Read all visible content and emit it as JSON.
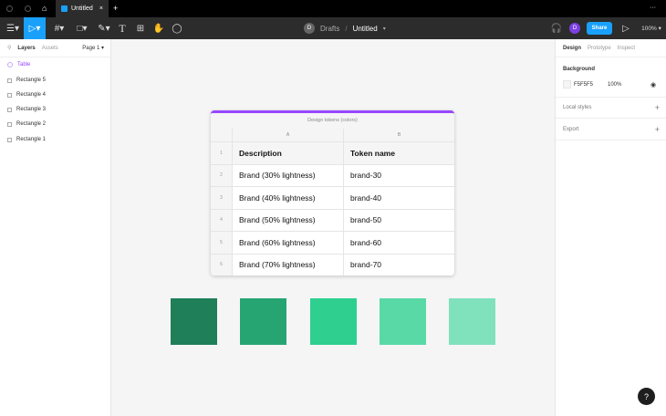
{
  "tab": {
    "title": "Untitled",
    "close": "×",
    "add": "+",
    "more": "···"
  },
  "toolbar": {
    "breadcrumb_parent": "Drafts",
    "separator": "/",
    "file_name": "Untitled",
    "avatar_initial": "D",
    "user_initial": "D",
    "share_label": "Share",
    "zoom": "100%",
    "text_tool": "T"
  },
  "left_panel": {
    "tabs": [
      "Layers",
      "Assets"
    ],
    "page": "Page 1",
    "layers": [
      "Table",
      "Rectangle 5",
      "Rectangle 4",
      "Rectangle 3",
      "Rectangle 2",
      "Rectangle 1"
    ]
  },
  "right_panel": {
    "tabs": [
      "Design",
      "Prototype",
      "Inspect"
    ],
    "background_label": "Background",
    "bg_hex": "F5F5F5",
    "bg_opacity": "100%",
    "local_styles": "Local styles",
    "export": "Export",
    "plus": "+"
  },
  "table": {
    "title": "Design tokens (colors)",
    "columns": [
      "A",
      "B"
    ],
    "rows": [
      {
        "n": "1",
        "a": "Description",
        "b": "Token name"
      },
      {
        "n": "2",
        "a": "Brand (30% lightness)",
        "b": "brand-30"
      },
      {
        "n": "3",
        "a": "Brand (40% lightness)",
        "b": "brand-40"
      },
      {
        "n": "4",
        "a": "Brand (50% lightness)",
        "b": "brand-50"
      },
      {
        "n": "5",
        "a": "Brand (60% lightness)",
        "b": "brand-60"
      },
      {
        "n": "6",
        "a": "Brand (70% lightness)",
        "b": "brand-70"
      }
    ]
  },
  "swatches": [
    "#1f7f58",
    "#26a572",
    "#2ecf8f",
    "#58d9a6",
    "#80e2bc"
  ],
  "help": "?"
}
